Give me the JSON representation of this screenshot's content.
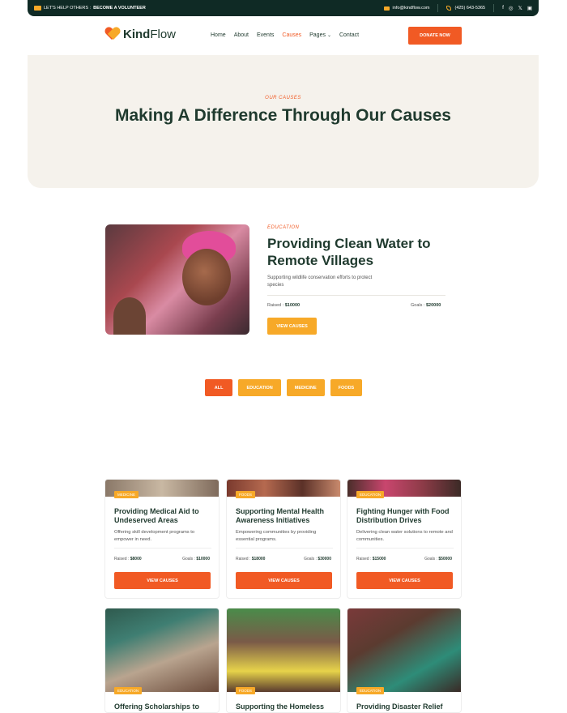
{
  "topbar": {
    "help_text": "LET'S HELP OTHERS :",
    "volunteer_link": "BECOME A VOLUNTEER",
    "email": "info@kindflow.com",
    "phone": "(425) 643-5365"
  },
  "brand": {
    "name_bold": "Kind",
    "name_light": "Flow"
  },
  "nav": {
    "items": [
      "Home",
      "About",
      "Events",
      "Causes",
      "Pages",
      "Contact"
    ],
    "active": "Causes"
  },
  "donate_label": "DONATE NOW",
  "hero": {
    "eyebrow": "OUR CAUSES",
    "title": "Making A Difference Through Our Causes"
  },
  "featured": {
    "category": "EDUCATION",
    "title": "Providing Clean Water to Remote Villages",
    "description": "Supporting wildlife conservation efforts to protect species",
    "raised_label": "Raised :",
    "raised_value": "$10000",
    "goals_label": "Goals :",
    "goals_value": "$20000",
    "button": "VIEW CAUSES"
  },
  "filters": [
    "ALL",
    "EDUCATION",
    "MEDICINE",
    "FOODS"
  ],
  "cards": [
    {
      "category": "MEDICINE",
      "title": "Providing Medical Aid to Undeserved Areas",
      "description": "Offering skill development programs to empower in need.",
      "raised_label": "Raised :",
      "raised": "$8000",
      "goals_label": "Goals :",
      "goals": "$10000",
      "button": "VIEW CAUSES"
    },
    {
      "category": "FOODS",
      "title": "Supporting Mental Health Awareness Initiatives",
      "description": "Empowering communities by providing essential programs.",
      "raised_label": "Raised :",
      "raised": "$18000",
      "goals_label": "Goals :",
      "goals": "$30000",
      "button": "VIEW CAUSES"
    },
    {
      "category": "EDUCATION",
      "title": "Fighting Hunger with Food Distribution Drives",
      "description": "Delivering clean water solutions to remote and communities.",
      "raised_label": "Raised :",
      "raised": "$15000",
      "goals_label": "Goals :",
      "goals": "$50000",
      "button": "VIEW CAUSES"
    },
    {
      "category": "EDUCATION",
      "title": "Offering Scholarships to"
    },
    {
      "category": "FOODS",
      "title": "Supporting the Homeless"
    },
    {
      "category": "EDUCATION",
      "title": "Providing Disaster Relief"
    }
  ],
  "colors": {
    "primary": "#f15a24",
    "secondary": "#f7a928",
    "dark": "#0f2a25",
    "hero_bg": "#f5f2ec"
  }
}
